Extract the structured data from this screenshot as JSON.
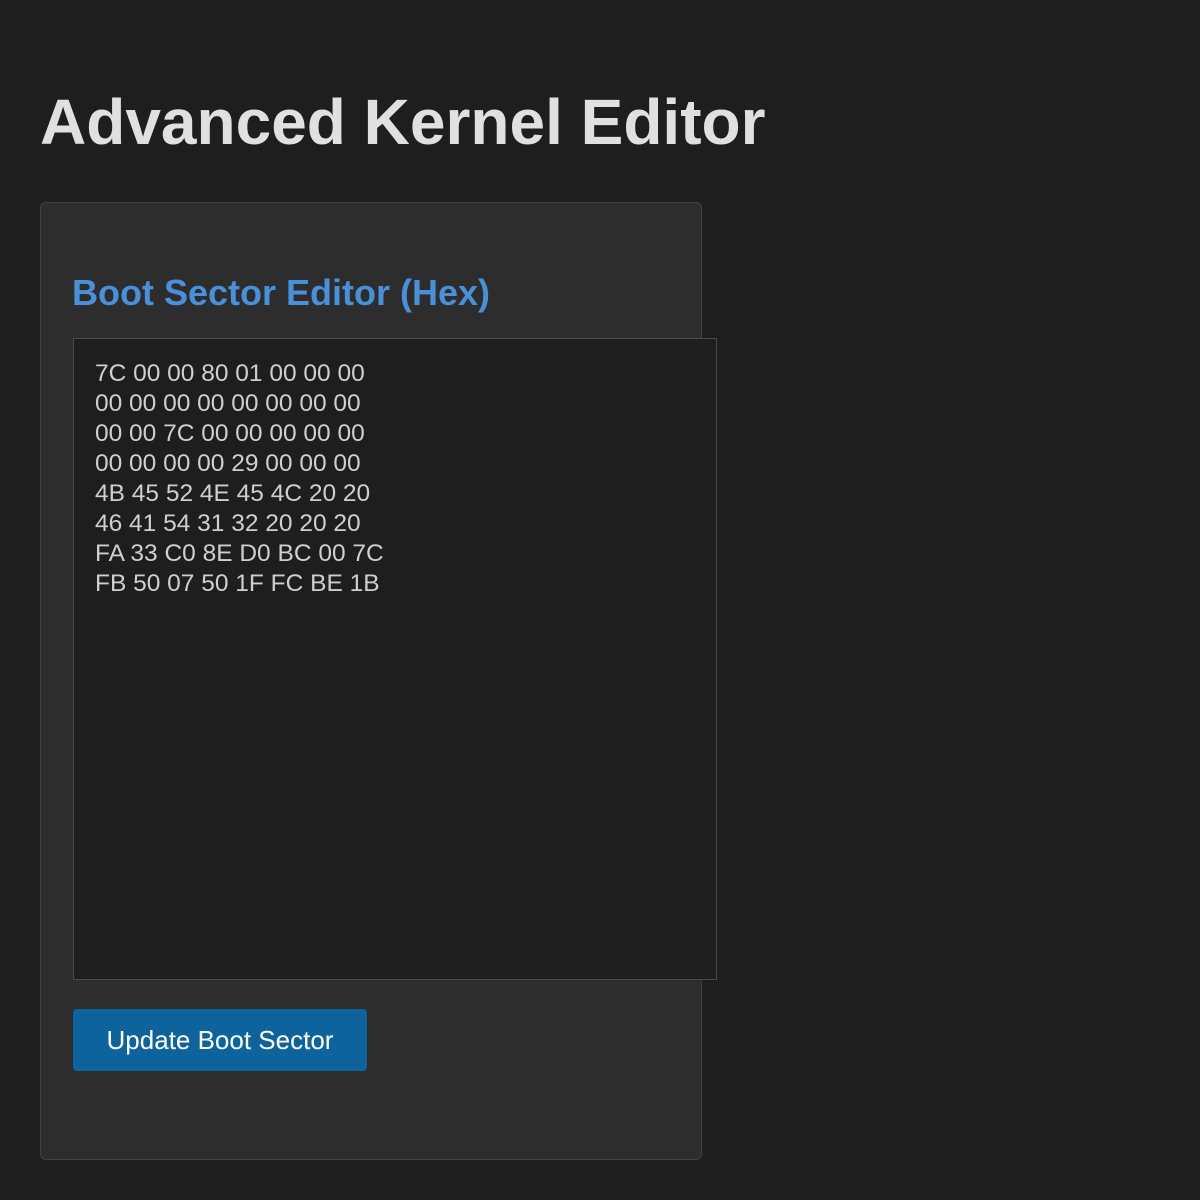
{
  "app": {
    "title": "Advanced Kernel Editor"
  },
  "boot_sector_panel": {
    "title": "Boot Sector Editor (Hex)",
    "hex_content": "7C 00 00 80 01 00 00 00\n00 00 00 00 00 00 00 00\n00 00 7C 00 00 00 00 00\n00 00 00 00 29 00 00 00\n4B 45 52 4E 45 4C 20 20\n46 41 54 31 32 20 20 20\nFA 33 C0 8E D0 BC 00 7C\nFB 50 07 50 1F FC BE 1B",
    "update_button_label": "Update Boot Sector"
  },
  "colors": {
    "background": "#1e1e1e",
    "panel": "#2d2d2d",
    "accent_title": "#4a90d9",
    "button": "#0e639c"
  }
}
